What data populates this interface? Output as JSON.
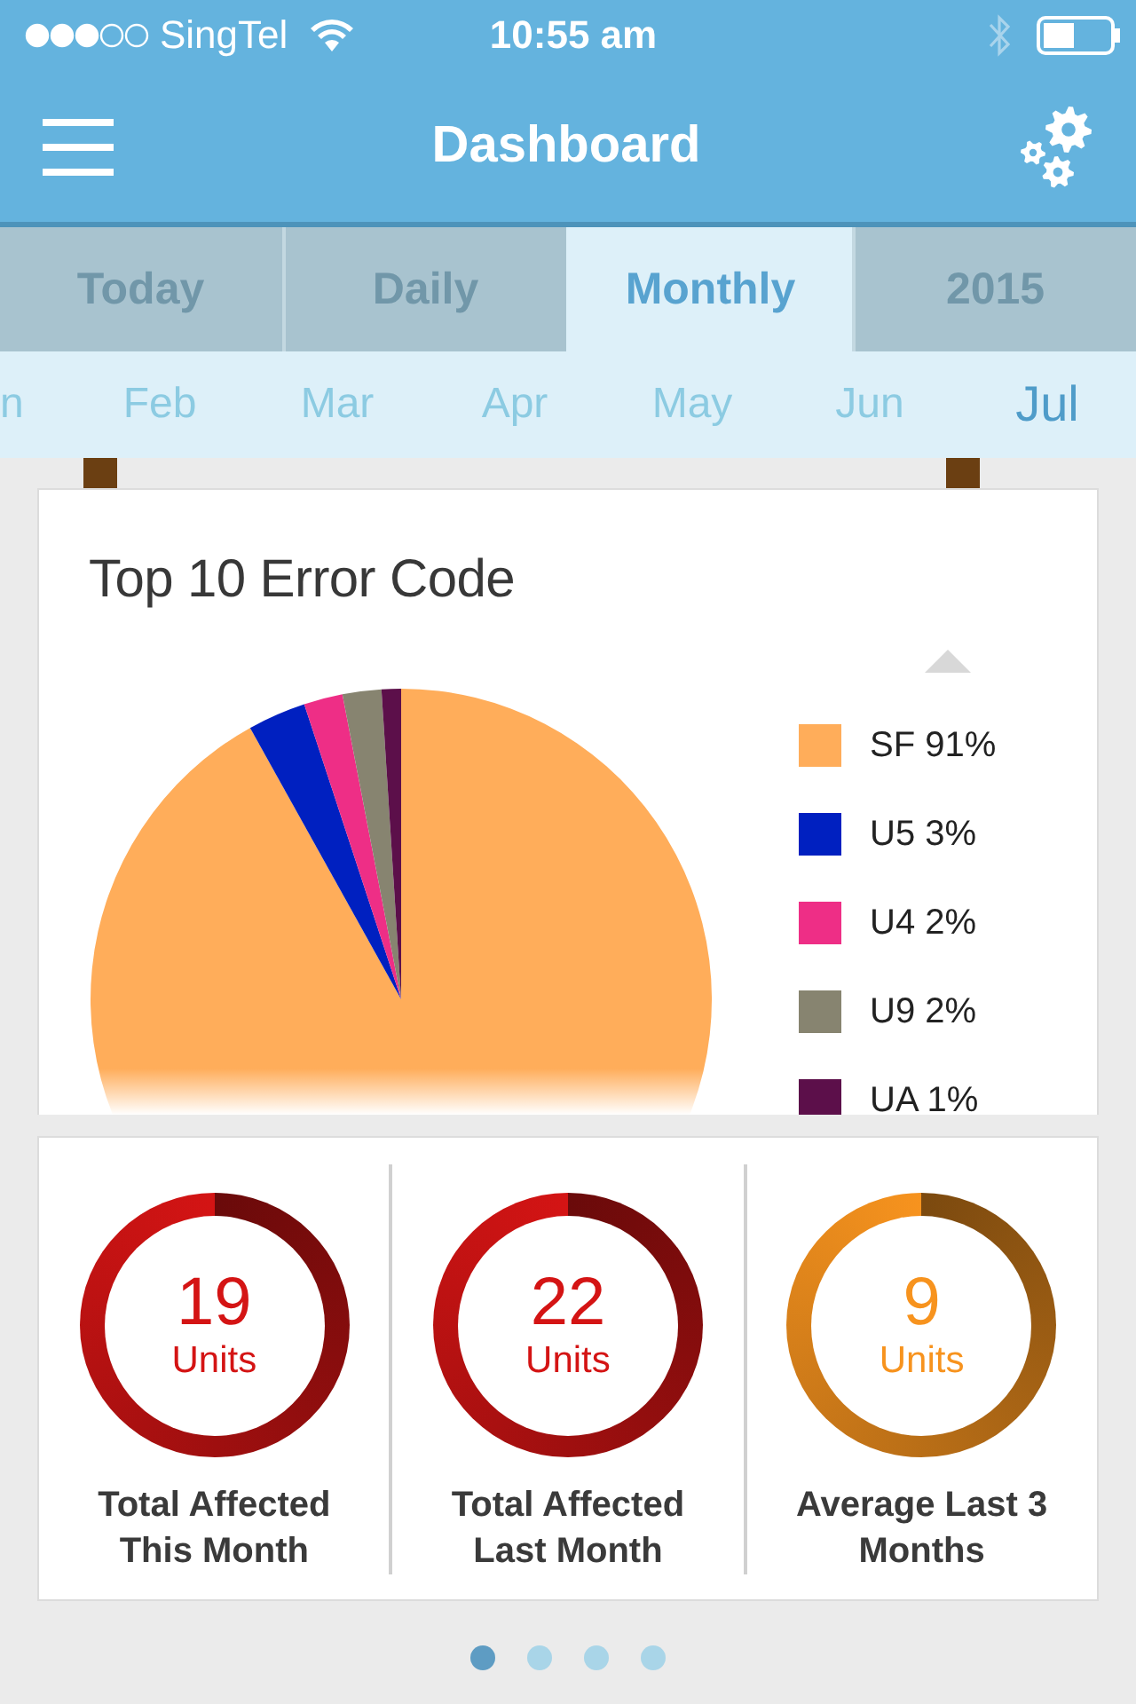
{
  "status_bar": {
    "carrier": "SingTel",
    "time": "10:55 am"
  },
  "header": {
    "title": "Dashboard"
  },
  "tabs": [
    {
      "label": "Today",
      "selected": false
    },
    {
      "label": "Daily",
      "selected": false
    },
    {
      "label": "Monthly",
      "selected": true
    },
    {
      "label": "2015",
      "selected": false
    }
  ],
  "months": [
    {
      "label": "n",
      "selected": false
    },
    {
      "label": "Feb",
      "selected": false
    },
    {
      "label": "Mar",
      "selected": false
    },
    {
      "label": "Apr",
      "selected": false
    },
    {
      "label": "May",
      "selected": false
    },
    {
      "label": "Jun",
      "selected": false
    },
    {
      "label": "Jul",
      "selected": true
    }
  ],
  "error_chart": {
    "chart_data": {
      "type": "pie",
      "title": "Top 10 Error Code",
      "categories": [
        "SF",
        "U5",
        "U4",
        "U9",
        "UA"
      ],
      "values": [
        91,
        3,
        2,
        2,
        1
      ]
    },
    "legend": [
      {
        "share": "91%",
        "color": "#ffad5a"
      },
      {
        "share": "3%",
        "color": "#0020c0"
      },
      {
        "share": "2%",
        "color": "#ee2e86"
      },
      {
        "share": "2%",
        "color": "#878470"
      },
      {
        "share": "1%",
        "color": "#5c0f4a"
      }
    ]
  },
  "stats": [
    {
      "value": "19",
      "unit": "Units",
      "label": "Total Affected This Month",
      "color": "#d41414"
    },
    {
      "value": "22",
      "unit": "Units",
      "label": "Total Affected Last Month",
      "color": "#d41414"
    },
    {
      "value": "9",
      "unit": "Units",
      "label": "Average Last 3 Months",
      "color": "#f7931e"
    }
  ],
  "pages": [
    {
      "selected": true
    },
    {
      "selected": false
    },
    {
      "selected": false
    },
    {
      "selected": false
    }
  ]
}
